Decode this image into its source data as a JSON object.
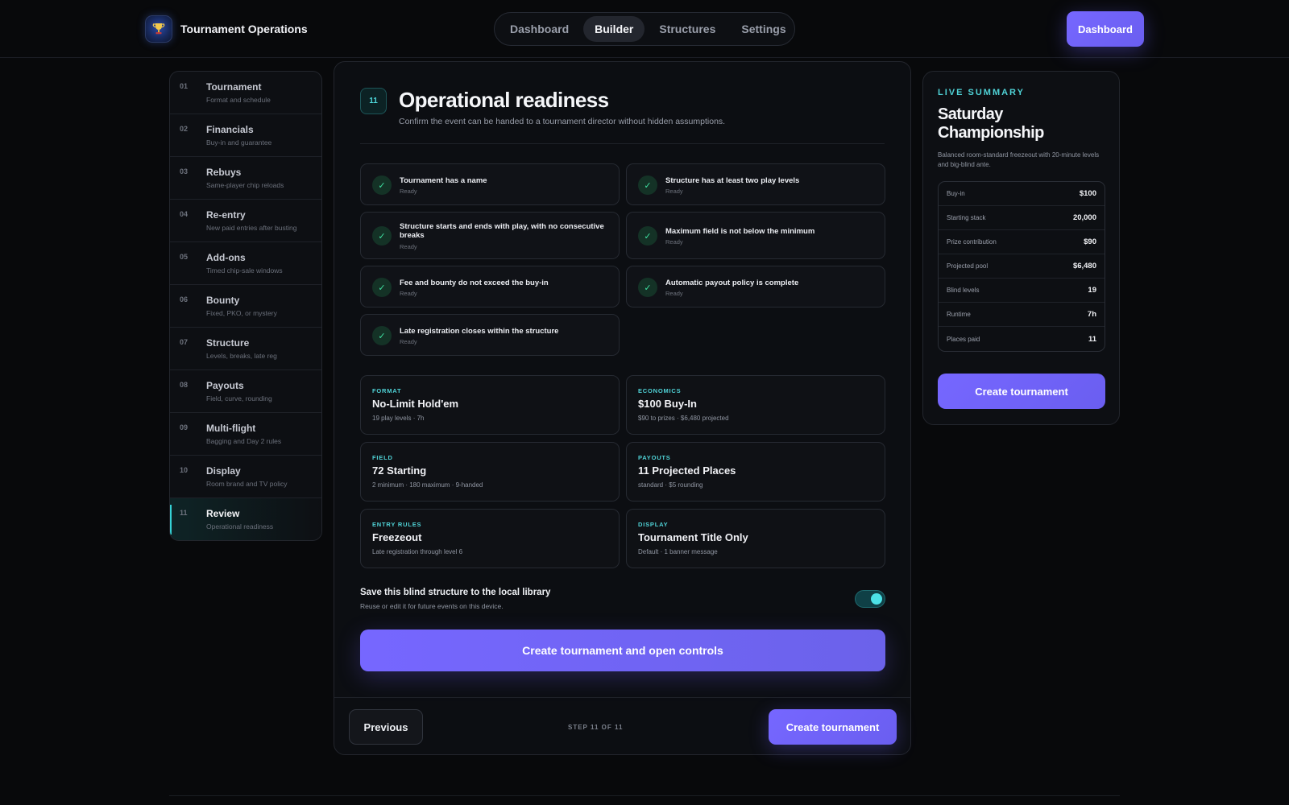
{
  "header": {
    "brand_title": "Tournament Operations",
    "tabs": [
      {
        "label": "Dashboard",
        "active": false
      },
      {
        "label": "Builder",
        "active": true
      },
      {
        "label": "Structures",
        "active": false
      },
      {
        "label": "Settings",
        "active": false
      }
    ],
    "action_label": "Dashboard"
  },
  "sidebar": {
    "steps": [
      {
        "num": "01",
        "title": "Tournament",
        "sub": "Format and schedule"
      },
      {
        "num": "02",
        "title": "Financials",
        "sub": "Buy-in and guarantee"
      },
      {
        "num": "03",
        "title": "Rebuys",
        "sub": "Same-player chip reloads"
      },
      {
        "num": "04",
        "title": "Re-entry",
        "sub": "New paid entries after busting"
      },
      {
        "num": "05",
        "title": "Add-ons",
        "sub": "Timed chip-sale windows"
      },
      {
        "num": "06",
        "title": "Bounty",
        "sub": "Fixed, PKO, or mystery"
      },
      {
        "num": "07",
        "title": "Structure",
        "sub": "Levels, breaks, late reg"
      },
      {
        "num": "08",
        "title": "Payouts",
        "sub": "Field, curve, rounding"
      },
      {
        "num": "09",
        "title": "Multi-flight",
        "sub": "Bagging and Day 2 rules"
      },
      {
        "num": "10",
        "title": "Display",
        "sub": "Room brand and TV policy"
      },
      {
        "num": "11",
        "title": "Review",
        "sub": "Operational readiness"
      }
    ]
  },
  "main": {
    "step_badge": "11",
    "title": "Operational readiness",
    "subtitle": "Confirm the event can be handed to a tournament director without hidden assumptions.",
    "checks": [
      {
        "label": "Tournament has a name",
        "status": "Ready"
      },
      {
        "label": "Structure has at least two play levels",
        "status": "Ready"
      },
      {
        "label": "Structure starts and ends with play, with no consecutive breaks",
        "status": "Ready"
      },
      {
        "label": "Maximum field is not below the minimum",
        "status": "Ready"
      },
      {
        "label": "Fee and bounty do not exceed the buy-in",
        "status": "Ready"
      },
      {
        "label": "Automatic payout policy is complete",
        "status": "Ready"
      },
      {
        "label": "Late registration closes within the structure",
        "status": "Ready"
      }
    ],
    "cards": [
      {
        "label": "FORMAT",
        "value": "No-Limit Hold'em",
        "detail": "19 play levels · 7h"
      },
      {
        "label": "ECONOMICS",
        "value": "$100 Buy-In",
        "detail": "$90 to prizes · $6,480 projected"
      },
      {
        "label": "FIELD",
        "value": "72 Starting",
        "detail": "2 minimum · 180 maximum · 9-handed"
      },
      {
        "label": "PAYOUTS",
        "value": "11 Projected Places",
        "detail": "standard · $5 rounding"
      },
      {
        "label": "ENTRY RULES",
        "value": "Freezeout",
        "detail": "Late registration through level 6"
      },
      {
        "label": "DISPLAY",
        "value": "Tournament Title Only",
        "detail": "Default · 1 banner message"
      }
    ],
    "save": {
      "title": "Save this blind structure to the local library",
      "subtitle": "Reuse or edit it for future events on this device.",
      "enabled": true
    },
    "primary_label": "Create tournament and open controls",
    "footer": {
      "prev_label": "Previous",
      "step_text": "STEP 11 OF 11",
      "next_label": "Create tournament"
    }
  },
  "summary": {
    "kicker": "LIVE SUMMARY",
    "title": "Saturday Championship",
    "description": "Balanced room-standard freezeout with 20-minute levels and big-blind ante.",
    "rows": [
      {
        "key": "Buy-in",
        "value": "$100"
      },
      {
        "key": "Starting stack",
        "value": "20,000"
      },
      {
        "key": "Prize contribution",
        "value": "$90"
      },
      {
        "key": "Projected pool",
        "value": "$6,480"
      },
      {
        "key": "Blind levels",
        "value": "19"
      },
      {
        "key": "Runtime",
        "value": "7h"
      },
      {
        "key": "Places paid",
        "value": "11"
      }
    ],
    "button_label": "Create tournament"
  },
  "colors": {
    "accent": "#7667ff",
    "teal": "#4fd2d6",
    "ready": "#3fe0a0",
    "background": "#08090b"
  }
}
